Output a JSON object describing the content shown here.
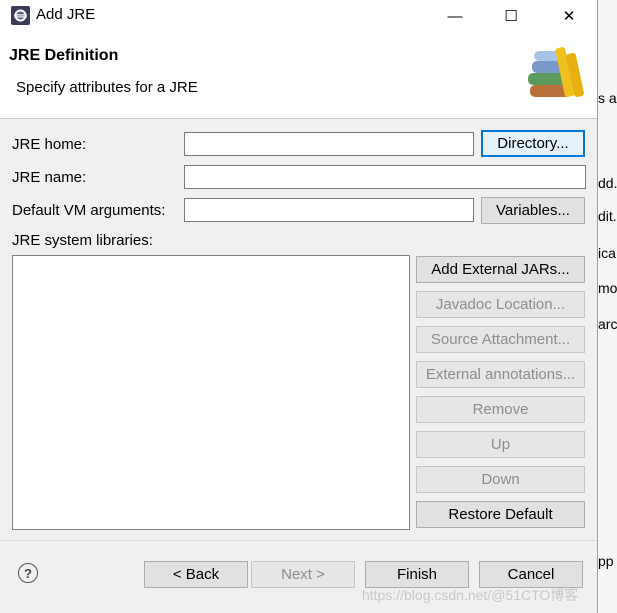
{
  "window": {
    "title": "Add JRE",
    "minimize": "—",
    "maximize": "☐",
    "close": "✕"
  },
  "banner": {
    "title": "JRE Definition",
    "subtitle": "Specify attributes for a JRE"
  },
  "form": {
    "jre_home_label": "JRE home:",
    "jre_home_value": "",
    "directory_button": "Directory...",
    "jre_name_label": "JRE name:",
    "jre_name_value": "",
    "vm_args_label": "Default VM arguments:",
    "vm_args_value": "",
    "variables_button": "Variables...",
    "libraries_label": "JRE system libraries:"
  },
  "library_buttons": [
    {
      "label": "Add External JARs...",
      "enabled": true
    },
    {
      "label": "Javadoc Location...",
      "enabled": false
    },
    {
      "label": "Source Attachment...",
      "enabled": false
    },
    {
      "label": "External annotations...",
      "enabled": false
    },
    {
      "label": "Remove",
      "enabled": false
    },
    {
      "label": "Up",
      "enabled": false
    },
    {
      "label": "Down",
      "enabled": false
    },
    {
      "label": "Restore Default",
      "enabled": true
    }
  ],
  "footer": {
    "help": "?",
    "back": "< Back",
    "next": "Next >",
    "finish": "Finish",
    "cancel": "Cancel"
  },
  "background_fragments": [
    "s a",
    "dd.",
    "dit.",
    "ica",
    "mo",
    "arch",
    "pp"
  ],
  "watermark": "https://blog.csdn.net/@51CTO博客",
  "colors": {
    "primary_border": "#0078d7",
    "disabled_text": "#8d8d8d"
  }
}
